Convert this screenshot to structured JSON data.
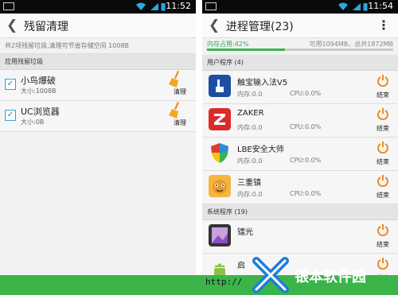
{
  "left_screen": {
    "status_time": "11:52",
    "title": "残留清理",
    "info_text": "共2项残留垃圾,清理可节省存储空间 1008B",
    "section_label": "应用残留垃圾",
    "items": [
      {
        "name": "小鸟爆破",
        "size": "大小:1008B",
        "action": "清理"
      },
      {
        "name": "UC浏览器",
        "size": "大小:0B",
        "action": "清理"
      }
    ]
  },
  "right_screen": {
    "status_time": "11:54",
    "title": "进程管理(23)",
    "memory_used": "内存占用:42%",
    "memory_used_fraction": 0.42,
    "memory_available": "可用1094MB，总共1872MB",
    "user_section": "用户程序 (4)",
    "system_section": "系统程序 (19)",
    "processes": [
      {
        "name": "触宝输入法V5",
        "mem": "内存:0.0",
        "cpu": "CPU:0.0%",
        "action": "结束",
        "icon": "touchpal-icon"
      },
      {
        "name": "ZAKER",
        "mem": "内存:0.0",
        "cpu": "CPU:0.0%",
        "action": "结束",
        "icon": "zaker-icon"
      },
      {
        "name": "LBE安全大师",
        "mem": "内存:0.0",
        "cpu": "CPU:0.0%",
        "action": "结束",
        "icon": "lbe-shield-icon"
      },
      {
        "name": "三重镇",
        "mem": "内存:0.0",
        "cpu": "CPU:0.0%",
        "action": "结束",
        "icon": "game-character-icon"
      }
    ],
    "system_processes": [
      {
        "name": "镭光",
        "action": "结束",
        "icon": "gallery-icon"
      },
      {
        "name": "启",
        "action": "结束",
        "icon": "android-icon"
      }
    ]
  },
  "watermark": {
    "url": "http://",
    "text": "银本软件园"
  },
  "colors": {
    "accent_green": "#3bb54a",
    "power_orange": "#f08a1c",
    "checkbox_blue": "#1a7fc0"
  }
}
